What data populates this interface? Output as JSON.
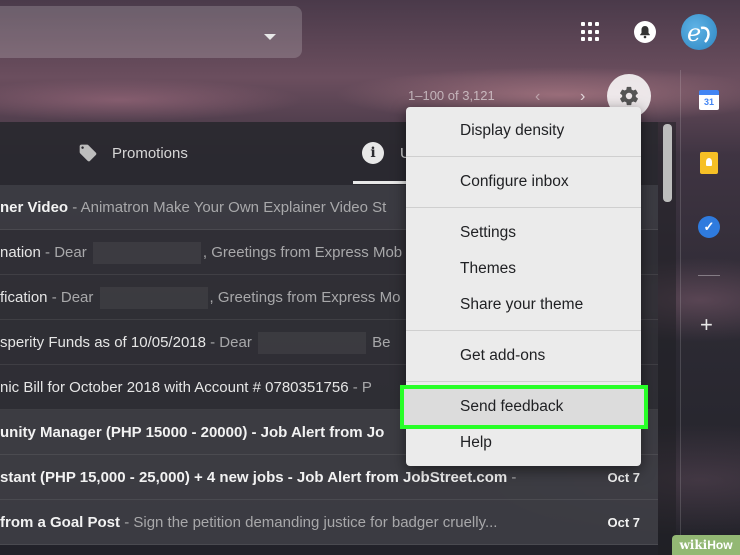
{
  "header": {
    "apps_icon": "apps-grid-icon",
    "notifications_icon": "bell-icon",
    "avatar_letter": "e"
  },
  "toolbar": {
    "pagination": "1–100 of 3,121",
    "prev_glyph": "‹",
    "next_glyph": "›",
    "settings_icon": "gear-icon"
  },
  "tabs": {
    "promotions_label": "Promotions",
    "promotions_icon": "tag-icon",
    "updates_icon": "info-icon",
    "updates_glyph": "i",
    "updates_label_fragment": "U"
  },
  "emails": [
    {
      "subject": "ner Video",
      "snippet": " - Animatron Make Your Own Explainer Video St",
      "date": "",
      "state": "first"
    },
    {
      "subject": "nation",
      "snippet": " - Dear ",
      "after_redact": ", Greetings from Express Mob",
      "date": "",
      "state": "read"
    },
    {
      "subject": "fication",
      "snippet": " - Dear ",
      "after_redact": ", Greetings from Express Mo",
      "date": "",
      "state": "read"
    },
    {
      "subject": "sperity Funds as of 10/05/2018",
      "snippet": " - Dear ",
      "after_redact": " Be",
      "date": "",
      "state": "read"
    },
    {
      "subject": "nic Bill for October 2018 with Account # 0780351756",
      "snippet": " - P",
      "date": "",
      "state": "read"
    },
    {
      "subject": "unity Manager (PHP 15000 - 20000) - Job Alert from Jo",
      "snippet": "",
      "date": "",
      "state": "unread"
    },
    {
      "subject": "stant (PHP 15,000 - 25,000) + 4 new jobs - Job Alert from JobStreet.com",
      "snippet": " -",
      "date": "Oct 7",
      "state": "unread"
    },
    {
      "subject": " from a Goal Post",
      "snippet": " - Sign the petition demanding justice for badger cruelly...",
      "date": "Oct 7",
      "state": "unread"
    }
  ],
  "side_panel": {
    "calendar_icon": "calendar-icon",
    "calendar_day": "31",
    "keep_icon": "keep-icon",
    "tasks_icon": "tasks-icon",
    "add_icon": "plus-icon",
    "add_glyph": "+"
  },
  "settings_menu": {
    "items": [
      {
        "label": "Display density"
      },
      {
        "label": "Configure inbox"
      },
      {
        "label": "Settings"
      },
      {
        "label": "Themes"
      },
      {
        "label": "Share your theme"
      },
      {
        "label": "Get add-ons"
      },
      {
        "label": "Send feedback",
        "highlighted": true
      },
      {
        "label": "Help"
      }
    ]
  },
  "watermark": {
    "text_a": "wiki",
    "text_b": "How"
  },
  "colors": {
    "highlight_outline": "#27ff27",
    "menu_bg": "#ebebeb"
  }
}
